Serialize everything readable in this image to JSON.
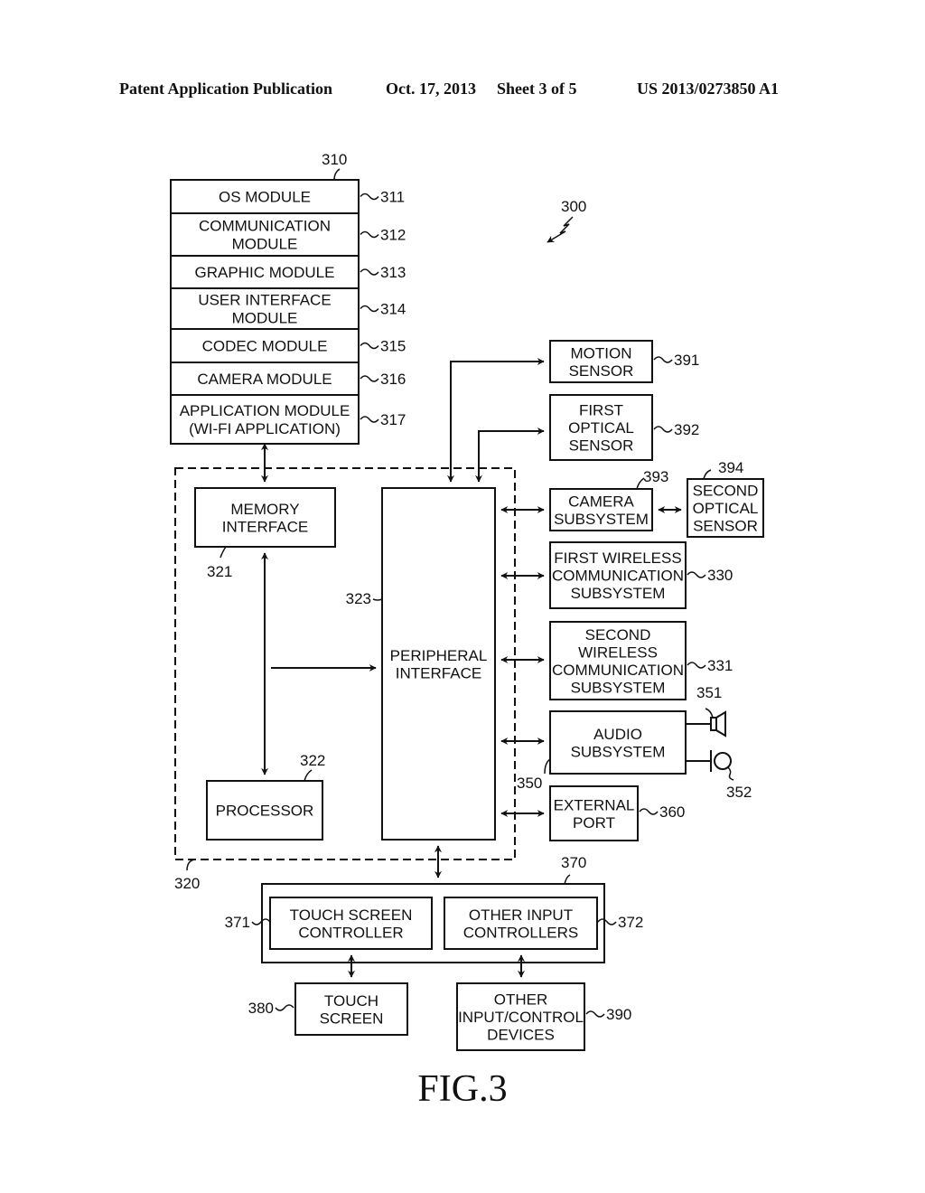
{
  "header": {
    "publication": "Patent Application Publication",
    "date": "Oct. 17, 2013",
    "sheet": "Sheet 3 of 5",
    "number": "US 2013/0273850 A1"
  },
  "figure": {
    "caption": "FIG.3",
    "system_ref": "300"
  },
  "memory_stack": {
    "ref": "310",
    "modules": [
      {
        "lines": [
          "OS MODULE"
        ],
        "ref": "311"
      },
      {
        "lines": [
          "COMMUNICATION",
          "MODULE"
        ],
        "ref": "312"
      },
      {
        "lines": [
          "GRAPHIC MODULE"
        ],
        "ref": "313"
      },
      {
        "lines": [
          "USER INTERFACE",
          "MODULE"
        ],
        "ref": "314"
      },
      {
        "lines": [
          "CODEC MODULE"
        ],
        "ref": "315"
      },
      {
        "lines": [
          "CAMERA MODULE"
        ],
        "ref": "316"
      },
      {
        "lines": [
          "APPLICATION MODULE",
          "(WI-FI APPLICATION)"
        ],
        "ref": "317"
      }
    ]
  },
  "controller": {
    "ref": "320",
    "memory_interface": {
      "lines": [
        "MEMORY",
        "INTERFACE"
      ],
      "ref": "321"
    },
    "processor": {
      "lines": [
        "PROCESSOR"
      ],
      "ref": "322"
    },
    "peripheral_interface": {
      "lines": [
        "PERIPHERAL",
        "INTERFACE"
      ],
      "ref": "323"
    }
  },
  "peripherals": {
    "motion_sensor": {
      "lines": [
        "MOTION",
        "SENSOR"
      ],
      "ref": "391"
    },
    "first_optical_sensor": {
      "lines": [
        "FIRST",
        "OPTICAL",
        "SENSOR"
      ],
      "ref": "392"
    },
    "camera_subsystem": {
      "lines": [
        "CAMERA",
        "SUBSYSTEM"
      ],
      "ref": "393"
    },
    "second_optical_sensor": {
      "lines": [
        "SECOND",
        "OPTICAL",
        "SENSOR"
      ],
      "ref": "394"
    },
    "first_wireless": {
      "lines": [
        "FIRST WIRELESS",
        "COMMUNICATION",
        "SUBSYSTEM"
      ],
      "ref": "330"
    },
    "second_wireless": {
      "lines": [
        "SECOND",
        "WIRELESS",
        "COMMUNICATION",
        "SUBSYSTEM"
      ],
      "ref": "331"
    },
    "audio_subsystem": {
      "lines": [
        "AUDIO",
        "SUBSYSTEM"
      ],
      "ref": "350"
    },
    "speaker_ref": "351",
    "microphone_ref": "352",
    "external_port": {
      "lines": [
        "EXTERNAL",
        "PORT"
      ],
      "ref": "360"
    }
  },
  "io_subsystem": {
    "ref": "370",
    "touch_screen_controller": {
      "lines": [
        "TOUCH SCREEN",
        "CONTROLLER"
      ],
      "ref": "371"
    },
    "other_input_controllers": {
      "lines": [
        "OTHER INPUT",
        "CONTROLLERS"
      ],
      "ref": "372"
    },
    "touch_screen": {
      "lines": [
        "TOUCH",
        "SCREEN"
      ],
      "ref": "380"
    },
    "other_devices": {
      "lines": [
        "OTHER",
        "INPUT/CONTROL",
        "DEVICES"
      ],
      "ref": "390"
    }
  }
}
